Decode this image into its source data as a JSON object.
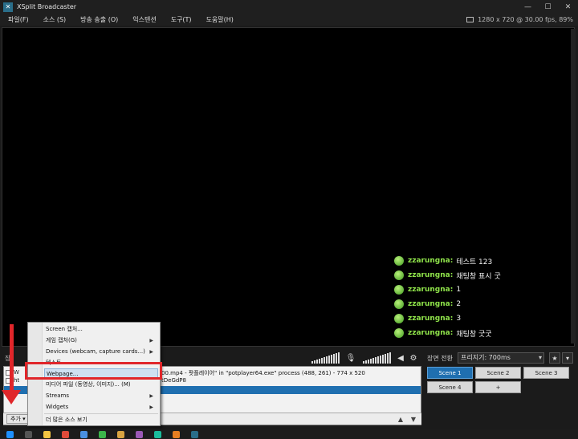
{
  "window": {
    "title": "XSplit Broadcaster",
    "icon": "xsplit-logo-icon"
  },
  "menu": [
    "파일(F)",
    "소스 (S)",
    "방송 송출 (O)",
    "익스텐션",
    "도구(T)",
    "도움말(H)"
  ],
  "stats": "1280 x 720 @ 30.00 fps, 89%",
  "chat": [
    {
      "user": "zzarungna:",
      "msg": "테스트 123"
    },
    {
      "user": "zzarungna:",
      "msg": "채팅창 표시 굿"
    },
    {
      "user": "zzarungna:",
      "msg": "1"
    },
    {
      "user": "zzarungna:",
      "msg": "2"
    },
    {
      "user": "zzarungna:",
      "msg": "3"
    },
    {
      "user": "zzarungna:",
      "msg": "채팅창 굿굿"
    }
  ],
  "sources_label": "장",
  "scene_transition": {
    "label": "장면 전환",
    "value": "프리지기: 700ms"
  },
  "sources": [
    {
      "text": "W",
      "tail": "00.mp4 - 팟플레이어\" in \"potplayer64.exe\" process (488, 261) - 774 x 520"
    },
    {
      "text": "ht",
      "tail": "tDeGdP8"
    },
    {
      "text": "",
      "tail": ""
    }
  ],
  "add_button": "추가 ▾",
  "context_menu": [
    {
      "label": "Screen 캡처...",
      "submenu": false
    },
    {
      "label": "게임 캡처(G)",
      "submenu": true
    },
    {
      "label": "Devices (webcam, capture cards...)",
      "submenu": true
    },
    {
      "label": "텍스트",
      "submenu": false
    },
    {
      "label": "Webpage...",
      "submenu": false
    },
    {
      "label": "미디어 파일 (동영상, 이미지)... (M)",
      "submenu": false
    },
    {
      "label": "Streams",
      "submenu": true
    },
    {
      "label": "Widgets",
      "submenu": true
    },
    {
      "label": "더 많은 소스 보기",
      "submenu": false
    }
  ],
  "scenes": [
    "Scene 1",
    "Scene 2",
    "Scene 3",
    "Scene 4",
    "+"
  ],
  "colors": {
    "accent": "#1f6fb0",
    "annotation": "#e0262a",
    "chat_user": "#8fe34a"
  }
}
